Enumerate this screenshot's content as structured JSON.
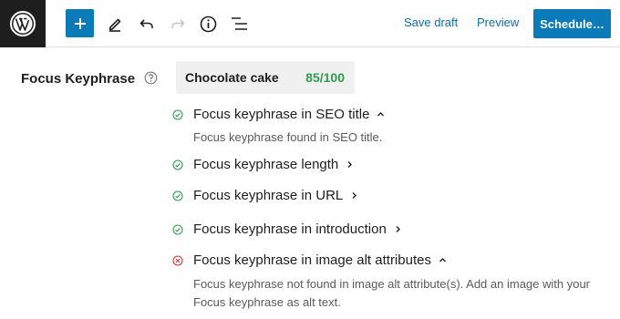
{
  "toolbar": {
    "logo_icon": "wordpress-logo-icon",
    "add_icon": "plus-icon",
    "edit_icon": "pencil-icon",
    "undo_icon": "undo-icon",
    "redo_icon": "redo-icon",
    "details_icon": "info-icon",
    "outline_icon": "list-view-icon",
    "save_draft": "Save draft",
    "preview": "Preview",
    "schedule": "Schedule…"
  },
  "focus_keyphrase": {
    "label": "Focus Keyphrase",
    "help_icon": "help-circle-icon",
    "value": "Chocolate cake",
    "score": "85/100",
    "score_color": "#2e9c4e"
  },
  "checks": [
    {
      "title": "Focus keyphrase in SEO title",
      "status": "good",
      "expanded": true,
      "description": "Focus keyphrase found in SEO title."
    },
    {
      "title": "Focus keyphrase length",
      "status": "good",
      "expanded": false
    },
    {
      "title": "Focus keyphrase in URL",
      "status": "good",
      "expanded": false
    },
    {
      "title": "Focus keyphrase in introduction",
      "status": "good",
      "expanded": false
    },
    {
      "title": "Focus keyphrase in image alt attributes",
      "status": "bad",
      "expanded": true,
      "description": "Focus keyphrase not found in image alt attribute(s). Add an image with your Focus keyphrase as alt text."
    }
  ],
  "colors": {
    "accent": "#0a7ab8",
    "good": "#2e9c4e",
    "bad": "#d63638",
    "link": "#0a6fa8"
  }
}
